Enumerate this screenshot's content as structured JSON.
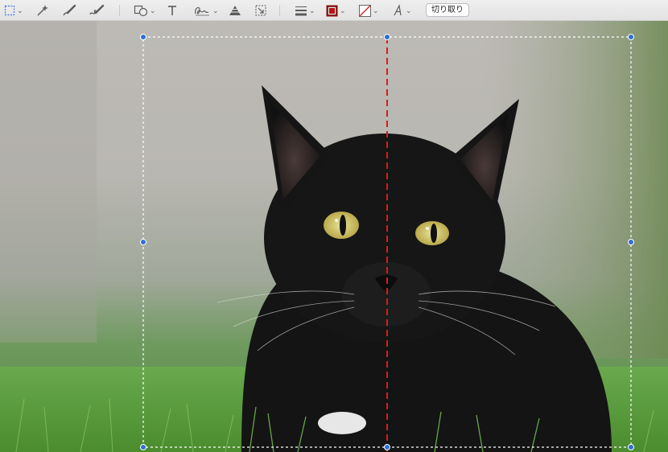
{
  "toolbar": {
    "crop_label": "切り取り",
    "tools": [
      "selection-rect-icon",
      "instant-alpha-icon",
      "sketch-icon",
      "draw-icon",
      "shapes-icon",
      "text-icon",
      "sign-icon",
      "adjust-color-icon",
      "adjust-size-icon",
      "shape-style-icon",
      "border-color-icon",
      "fill-color-icon",
      "text-style-icon"
    ]
  },
  "colors": {
    "accent": "#2f6fd6",
    "border_color": "#b31414",
    "guide_line": "#d21e1e"
  }
}
